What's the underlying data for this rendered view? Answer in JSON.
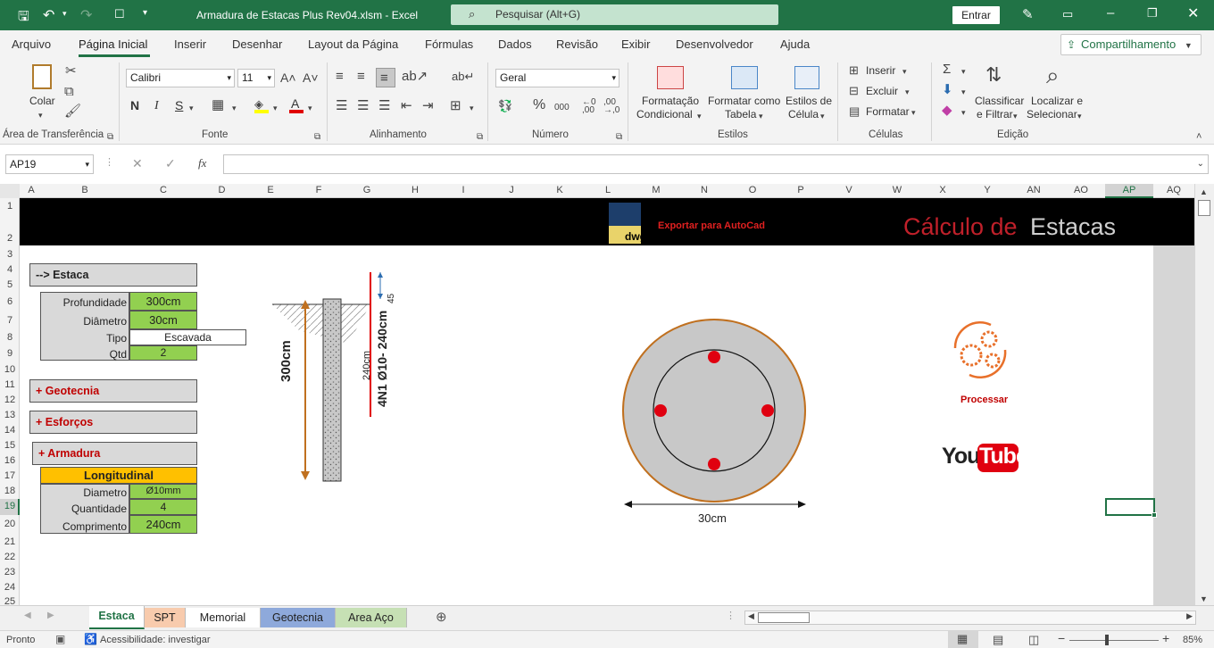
{
  "window": {
    "title": "Armadura de Estacas Plus Rev04.xlsm  -  Excel",
    "search_placeholder": "Pesquisar (Alt+G)",
    "signin": "Entrar"
  },
  "menu": {
    "tabs": [
      "Arquivo",
      "Página Inicial",
      "Inserir",
      "Desenhar",
      "Layout da Página",
      "Fórmulas",
      "Dados",
      "Revisão",
      "Exibir",
      "Desenvolvedor",
      "Ajuda"
    ],
    "share": "Compartilhamento"
  },
  "ribbon": {
    "paste": "Colar",
    "clipboard_group": "Área de Transferência",
    "font_name": "Calibri",
    "font_size": "11",
    "bold": "N",
    "italic": "I",
    "underline": "S",
    "font_group": "Fonte",
    "alignment_group": "Alinhamento",
    "number_format": "Geral",
    "number_group": "Número",
    "cond_format_1": "Formatação",
    "cond_format_2": "Condicional",
    "format_table_1": "Formatar como",
    "format_table_2": "Tabela",
    "cell_styles_1": "Estilos de",
    "cell_styles_2": "Célula",
    "styles_group": "Estilos",
    "insert": "Inserir",
    "delete": "Excluir",
    "format": "Formatar",
    "cells_group": "Células",
    "sort_1": "Classificar",
    "sort_2": "e Filtrar",
    "find_1": "Localizar e",
    "find_2": "Selecionar",
    "editing_group": "Edição"
  },
  "formula_bar": {
    "name_box": "AP19",
    "fx": "fx",
    "formula": ""
  },
  "columns": [
    "A",
    "B",
    "C",
    "D",
    "E",
    "F",
    "G",
    "H",
    "I",
    "J",
    "K",
    "L",
    "M",
    "N",
    "O",
    "P",
    "V",
    "W",
    "X",
    "Y",
    "AN",
    "AO",
    "AP",
    "AQ"
  ],
  "rows": [
    "1",
    "2",
    "3",
    "4",
    "5",
    "6",
    "7",
    "8",
    "9",
    "10",
    "11",
    "12",
    "13",
    "14",
    "15",
    "16",
    "17",
    "18",
    "19",
    "20",
    "21",
    "22",
    "23",
    "24",
    "25"
  ],
  "banner": {
    "export": "Exportar para AutoCad",
    "dwg": "dwg",
    "title_a": "Cálculo de",
    "title_b": "Estacas"
  },
  "estaca": {
    "header": "--> Estaca",
    "profundidade_label": "Profundidade",
    "profundidade": "300cm",
    "diametro_label": "Diâmetro",
    "diametro": "30cm",
    "tipo_label": "Tipo",
    "tipo": "Escavada",
    "qtd_label": "Qtd",
    "qtd": "2"
  },
  "sections": {
    "geotecnia": "+ Geotecnia",
    "esforcos": "+ Esforços",
    "armadura": "+ Armadura"
  },
  "longitudinal": {
    "header": "Longitudinal",
    "diametro_label": "Diametro",
    "diametro": "Ø10mm",
    "quantidade_label": "Quantidade",
    "quantidade": "4",
    "comprimento_label": "Comprimento",
    "comprimento": "240cm"
  },
  "drawing": {
    "depth_label": "300cm",
    "bar_len_label": "240cm",
    "bar_spec": "4N1 Ø10- 240cm",
    "top_offset": "45",
    "section_width": "30cm"
  },
  "actions": {
    "process": "Processar",
    "youtube_a": "You",
    "youtube_b": "Tube"
  },
  "sheet_tabs": [
    "Estaca",
    "SPT",
    "Memorial",
    "Geotecnia",
    "Area Aço"
  ],
  "status": {
    "ready": "Pronto",
    "accessibility": "Acessibilidade: investigar",
    "zoom": "85%"
  },
  "colors": {
    "excel_green": "#217346",
    "input_green": "#92d050",
    "section_red": "#c00000",
    "header_orange": "#ffc000",
    "bar_red": "#e00000"
  }
}
